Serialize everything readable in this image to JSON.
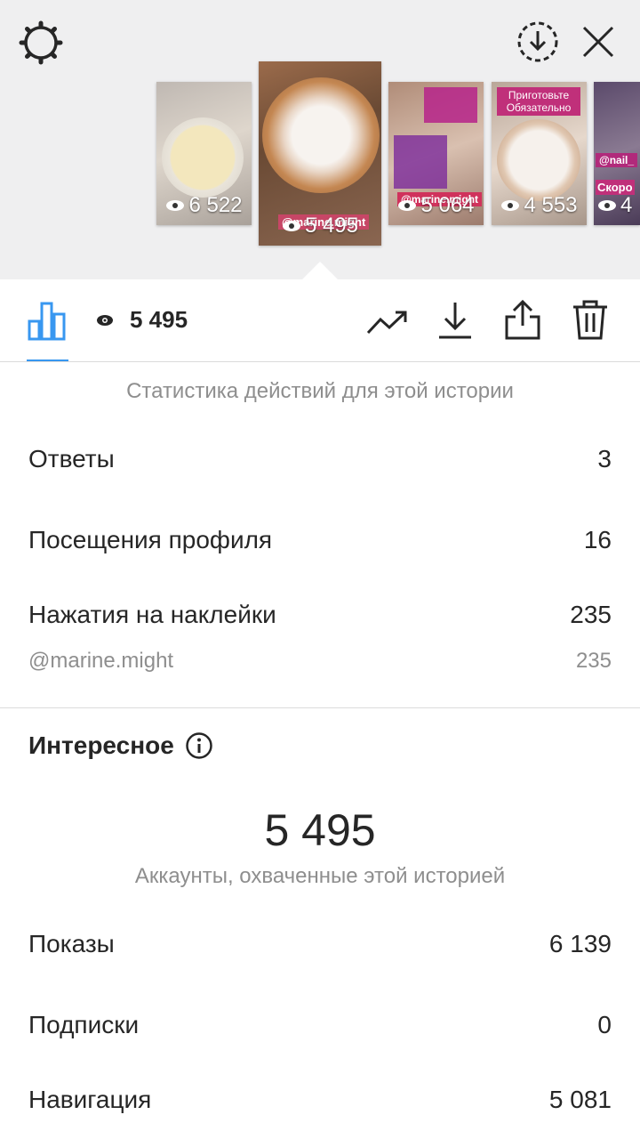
{
  "stories": [
    {
      "views": "6 522"
    },
    {
      "views": "5 495",
      "mention": "@marine.might"
    },
    {
      "views": "5 064",
      "mention": "@marine.might"
    },
    {
      "views": "4 553",
      "caption": "Приготовьте Обязательно"
    },
    {
      "views": "4",
      "mention": "@nail_",
      "caption": "Скоро"
    }
  ],
  "toolbar": {
    "views": "5 495"
  },
  "header_caption": "Статистика действий для этой истории",
  "actions": [
    {
      "label": "Ответы",
      "value": "3"
    },
    {
      "label": "Посещения профиля",
      "value": "16"
    },
    {
      "label": "Нажатия на наклейки",
      "value": "235"
    }
  ],
  "sticker_detail": {
    "label": "@marine.might",
    "value": "235"
  },
  "discovery": {
    "title": "Интересное",
    "reach_value": "5 495",
    "reach_label": "Аккаунты, охваченные этой историей",
    "rows": [
      {
        "label": "Показы",
        "value": "6 139"
      },
      {
        "label": "Подписки",
        "value": "0"
      },
      {
        "label": "Навигация",
        "value": "5 081"
      }
    ]
  },
  "colors": {
    "accent": "#3897f0",
    "pink": "#d0325c"
  }
}
